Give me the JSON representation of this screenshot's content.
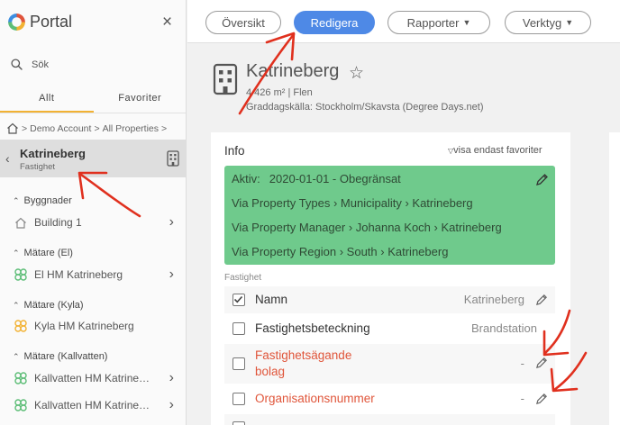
{
  "sidebar": {
    "brand": "Portal",
    "close_label": "×",
    "search_placeholder": "Sök",
    "tabs": [
      "Allt",
      "Favoriter"
    ],
    "breadcrumb": [
      "Demo Account",
      "All Properties"
    ],
    "selected_property": {
      "name": "Katrineberg",
      "type": "Fastighet"
    },
    "sections": [
      {
        "title": "Byggnader",
        "items": [
          "Building 1"
        ]
      },
      {
        "title": "Mätare (El)",
        "items": [
          "El HM Katrineberg"
        ]
      },
      {
        "title": "Mätare (Kyla)",
        "items": [
          "Kyla HM Katrineberg"
        ]
      },
      {
        "title": "Mätare (Kallvatten)",
        "items": [
          "Kallvatten HM Katrine…",
          "Kallvatten HM Katrine…"
        ]
      }
    ]
  },
  "topbar": {
    "tabs": [
      "Översikt",
      "Redigera",
      "Rapporter",
      "Verktyg"
    ],
    "active_tab": "Redigera"
  },
  "property": {
    "title": "Katrineberg",
    "meta_line1": "4 426 m² | Flen",
    "meta_line2": "Graddagskälla: Stockholm/Skavsta (Degree Days.net)"
  },
  "info": {
    "title": "Info",
    "favorites_filter": "visa endast favoriter",
    "active_label": "Aktiv:",
    "active_value": "2020-01-01 - Obegränsat",
    "via_rows": [
      [
        "Via Property Types",
        "Municipality",
        "Katrineberg"
      ],
      [
        "Via Property Manager",
        "Johanna Koch",
        "Katrineberg"
      ],
      [
        "Via Property Region",
        "South",
        "Katrineberg"
      ]
    ],
    "section_label": "Fastighet",
    "fields": [
      {
        "name": "Namn",
        "value": "Katrineberg",
        "checked": true,
        "highlight": false
      },
      {
        "name": "Fastighetsbeteckning",
        "value": "Brandstation",
        "checked": false,
        "highlight": false
      },
      {
        "name": "Fastighetsägande bolag",
        "name_line1": "Fastighetsägande",
        "name_line2": "bolag",
        "value": "-",
        "checked": false,
        "highlight": true
      },
      {
        "name": "Organisationsnummer",
        "value": "-",
        "checked": false,
        "highlight": true
      }
    ]
  },
  "colors": {
    "accent": "#4e89e6",
    "active_block": "#6fca8c",
    "highlight_text": "#e0553a",
    "annotation_arrows": "#e0301e",
    "tab_underline": "#f2b233"
  }
}
